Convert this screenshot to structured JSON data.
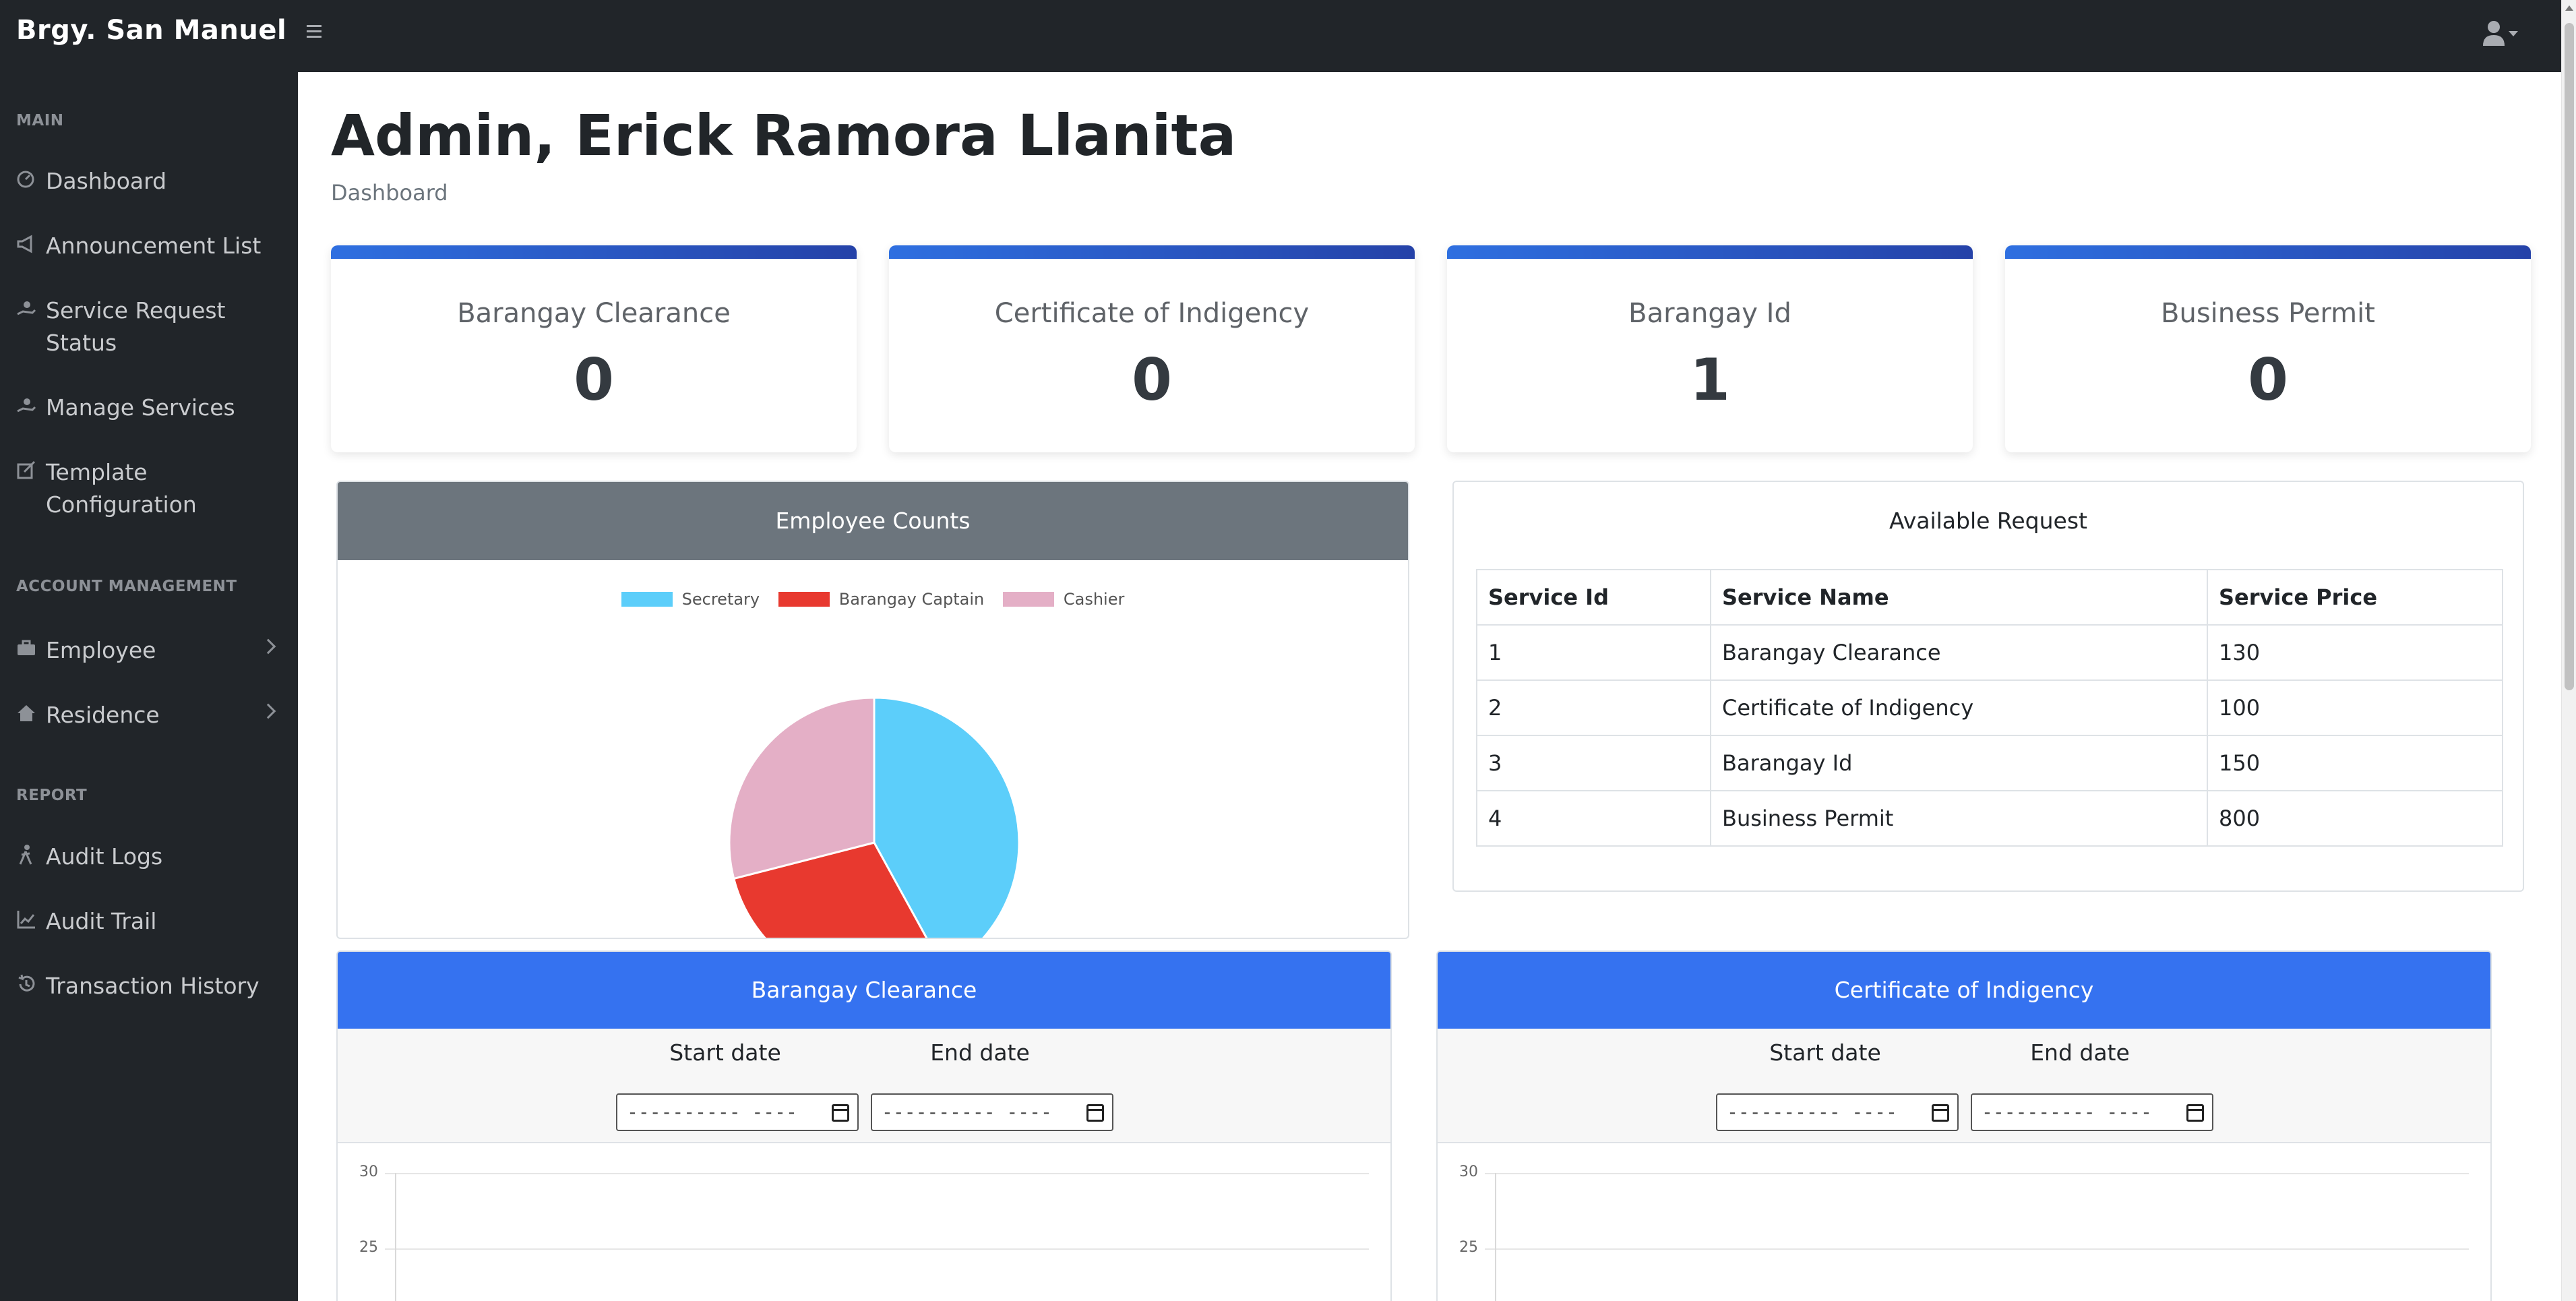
{
  "app": {
    "brand": "Brgy. San Manuel"
  },
  "sidebar": {
    "headings": {
      "main": "MAIN",
      "account": "ACCOUNT MANAGEMENT",
      "report": "REPORT"
    },
    "items": [
      {
        "label": "Dashboard",
        "icon": "dashboard-icon"
      },
      {
        "label": "Announcement List",
        "icon": "megaphone-icon"
      },
      {
        "label": "Service Request Status",
        "icon": "hand-icon"
      },
      {
        "label": "Manage Services",
        "icon": "hand-icon"
      },
      {
        "label": "Template Configuration",
        "icon": "edit-icon"
      },
      {
        "label": "Employee",
        "icon": "briefcase-icon"
      },
      {
        "label": "Residence",
        "icon": "house-icon"
      },
      {
        "label": "Audit Logs",
        "icon": "walk-icon"
      },
      {
        "label": "Audit Trail",
        "icon": "line-chart-icon"
      },
      {
        "label": "Transaction History",
        "icon": "history-icon"
      }
    ]
  },
  "page": {
    "title": "Admin, Erick Ramora Llanita",
    "breadcrumb": "Dashboard"
  },
  "stats": [
    {
      "label": "Barangay Clearance",
      "value": "0"
    },
    {
      "label": "Certificate of Indigency",
      "value": "0"
    },
    {
      "label": "Barangay Id",
      "value": "1"
    },
    {
      "label": "Business Permit",
      "value": "0"
    }
  ],
  "employee_counts": {
    "title": "Employee Counts"
  },
  "available_request": {
    "title": "Available Request",
    "headers": [
      "Service Id",
      "Service Name",
      "Service Price"
    ],
    "rows": [
      [
        "1",
        "Barangay Clearance",
        "130"
      ],
      [
        "2",
        "Certificate of Indigency",
        "100"
      ],
      [
        "3",
        "Barangay Id",
        "150"
      ],
      [
        "4",
        "Business Permit",
        "800"
      ]
    ]
  },
  "panels": [
    {
      "title": "Barangay Clearance",
      "start_label": "Start date",
      "end_label": "End date",
      "date_placeholder": "---------- ----",
      "ticks": [
        "30",
        "25"
      ]
    },
    {
      "title": "Certificate of Indigency",
      "start_label": "Start date",
      "end_label": "End date",
      "date_placeholder": "---------- ----",
      "ticks": [
        "30",
        "25"
      ]
    }
  ],
  "chart_data": {
    "type": "pie",
    "labels": [
      "Secretary",
      "Barangay Captain",
      "Cashier"
    ],
    "values": [
      42,
      29,
      29
    ],
    "colors": [
      "#5ccefa",
      "#e8392f",
      "#e4afc6"
    ]
  },
  "colors": {
    "topbar": "#212529",
    "accent_blue": "#3572f0",
    "panel_gray": "#6c757d"
  }
}
